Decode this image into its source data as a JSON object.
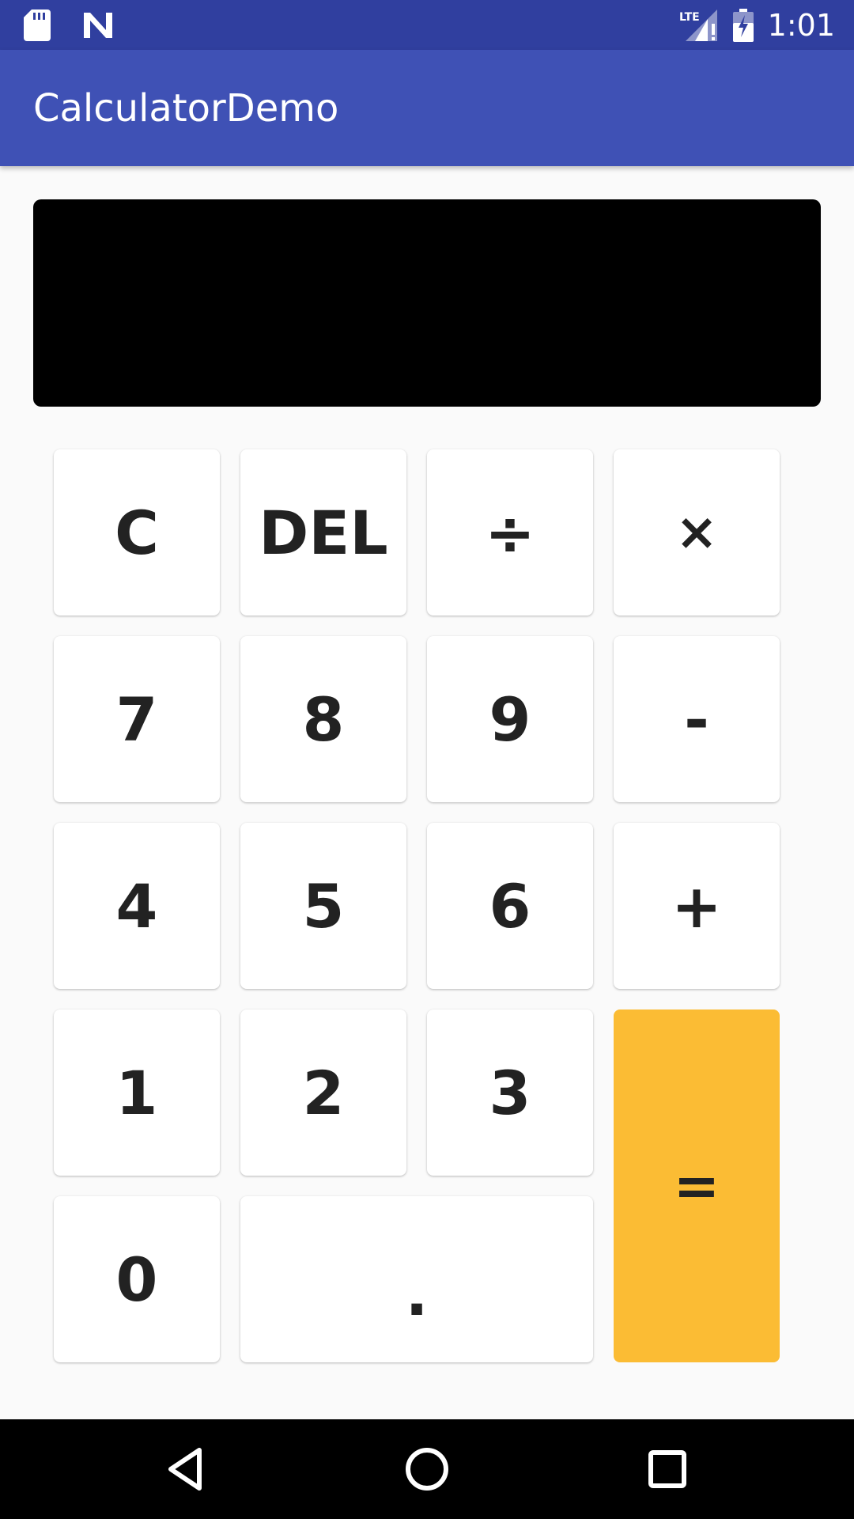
{
  "status_bar": {
    "time": "1:01",
    "left_icons": [
      "sd-card-icon",
      "n-notification-icon"
    ],
    "right_icons": [
      "lte-signal-icon",
      "battery-charging-icon"
    ],
    "network_label": "LTE",
    "background": "#303f9f"
  },
  "app_bar": {
    "title": "CalculatorDemo",
    "background": "#3f51b5"
  },
  "display": {
    "value": "",
    "background": "#000000"
  },
  "keypad": {
    "clear": "C",
    "delete": "DEL",
    "divide": "÷",
    "multiply": "×",
    "seven": "7",
    "eight": "8",
    "nine": "9",
    "minus": "-",
    "four": "4",
    "five": "5",
    "six": "6",
    "plus": "+",
    "one": "1",
    "two": "2",
    "three": "3",
    "zero": "0",
    "decimal": ".",
    "equals": "=",
    "key_background": "#ffffff",
    "equals_background": "#fbbc34"
  },
  "nav_bar": {
    "icons": [
      "back-icon",
      "home-icon",
      "recents-icon"
    ],
    "background": "#000000"
  }
}
